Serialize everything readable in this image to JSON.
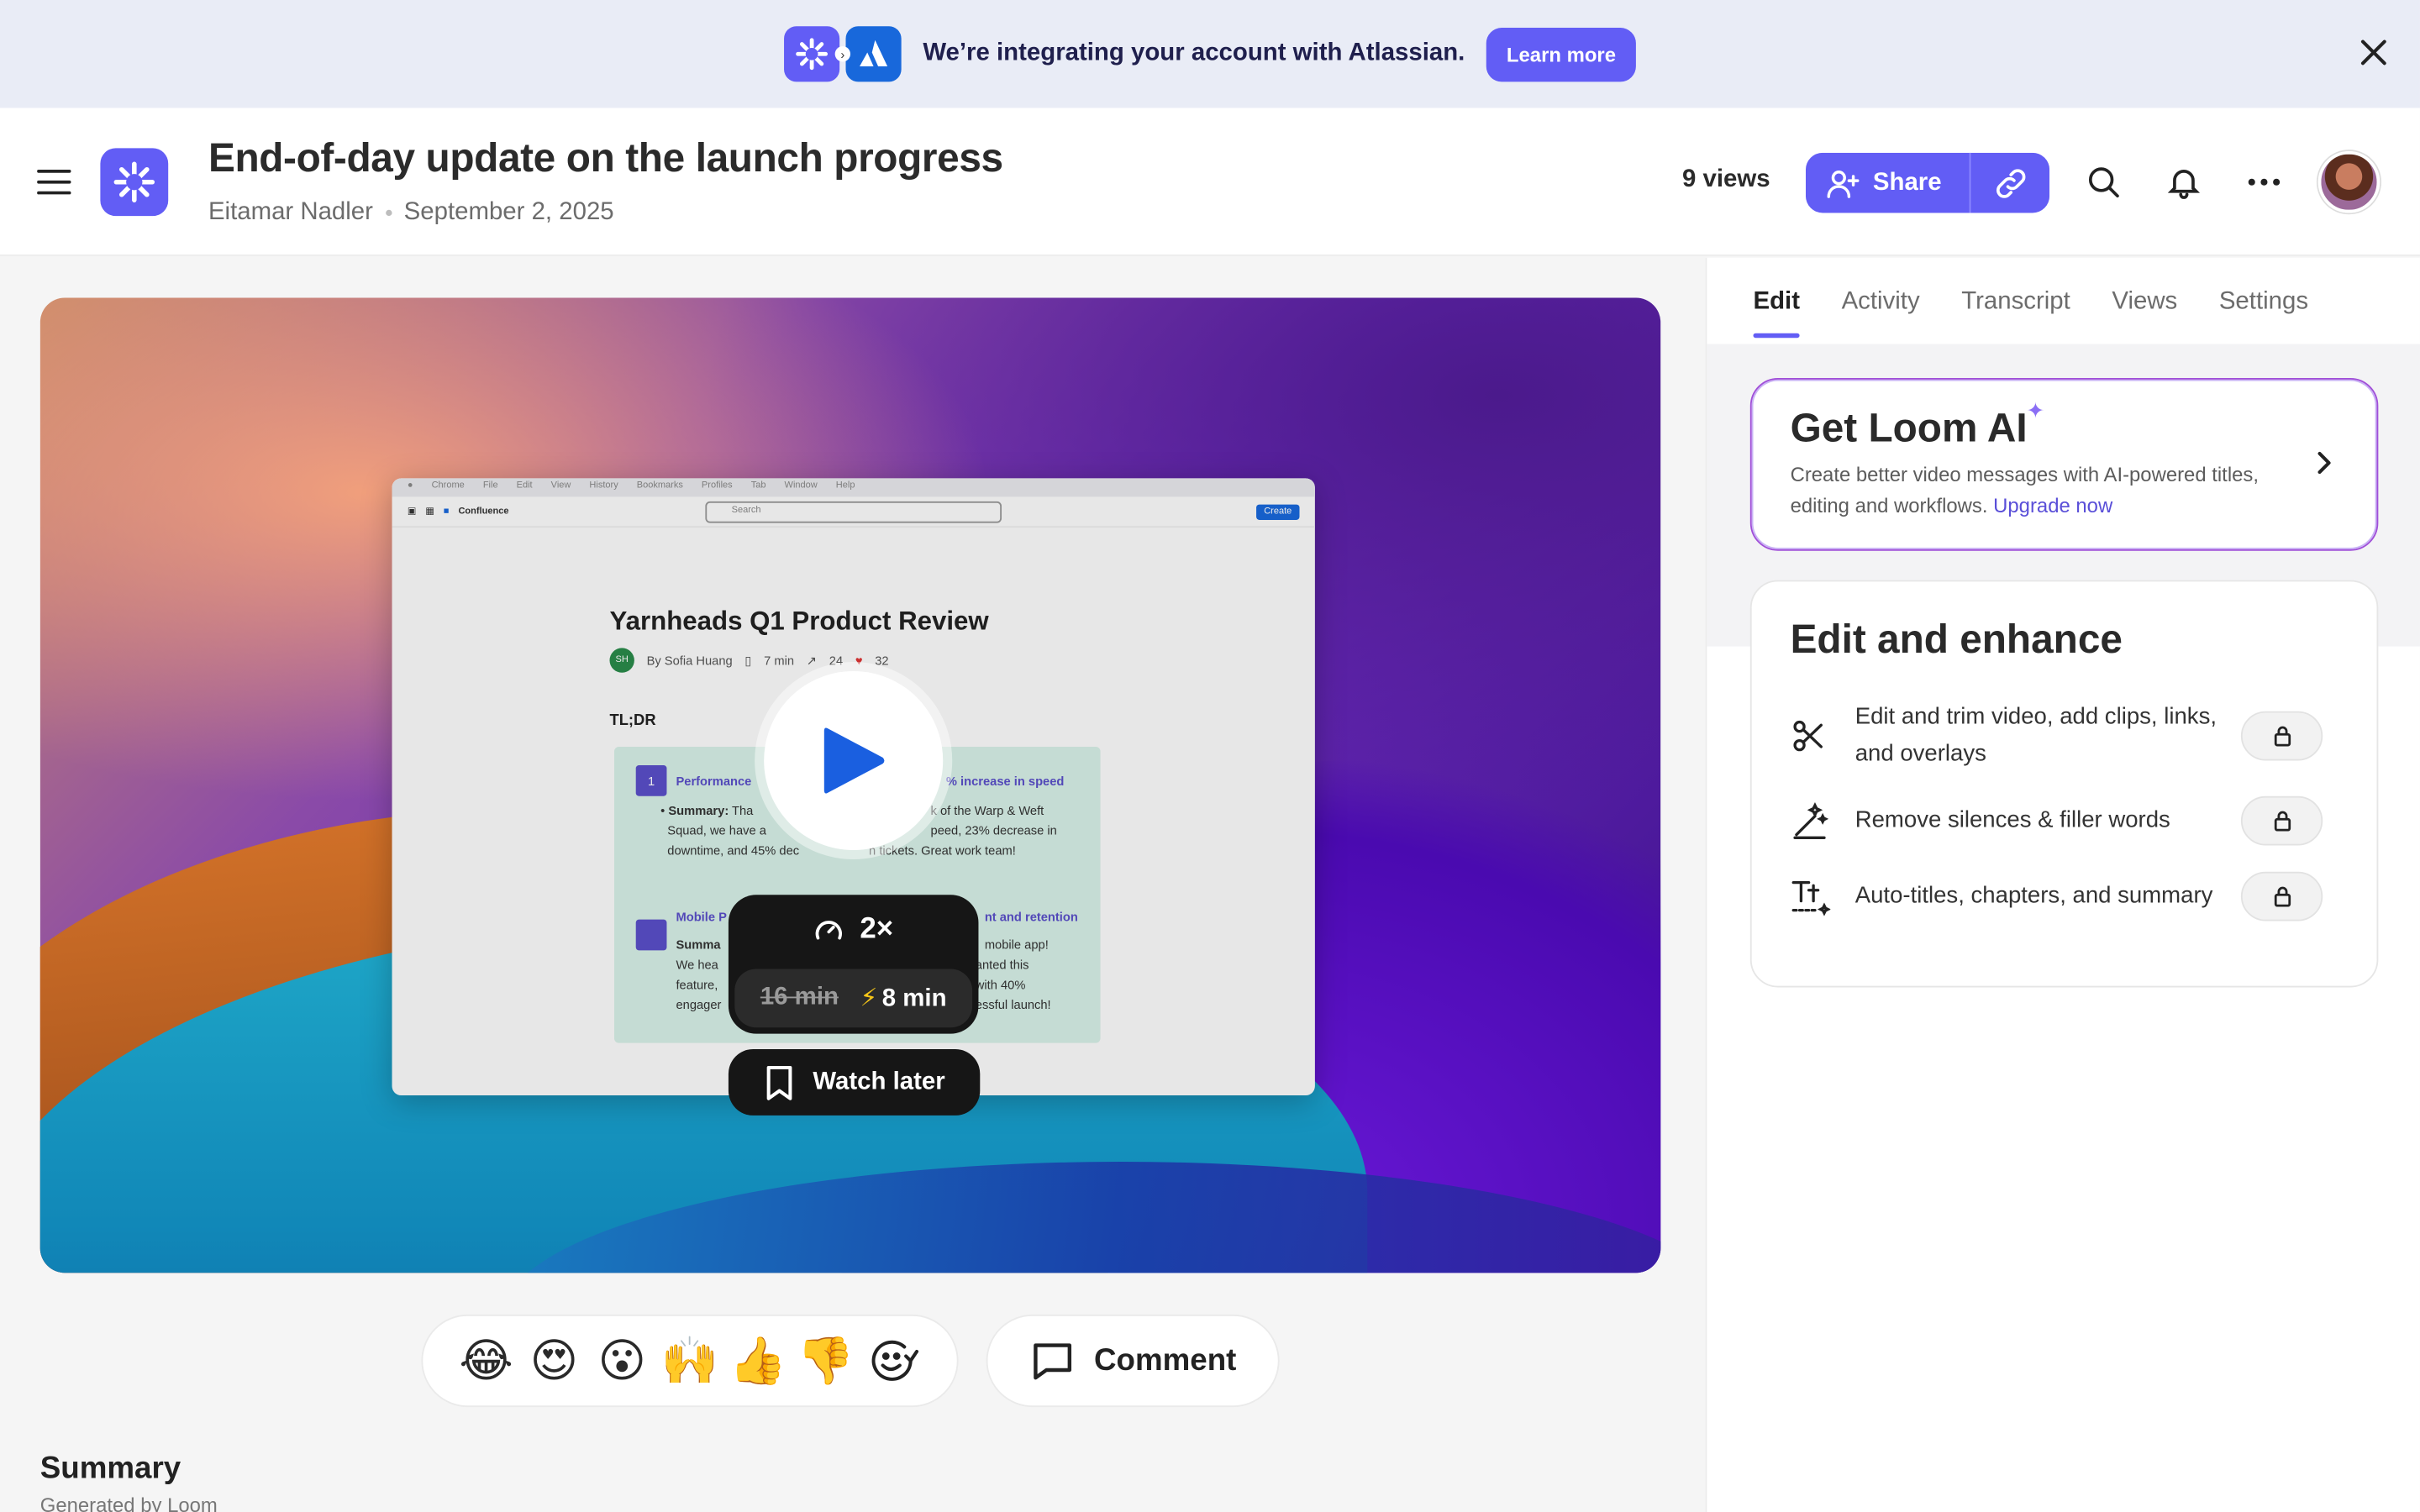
{
  "banner": {
    "message": "We’re integrating your account with Atlassian.",
    "learn_more": "Learn more"
  },
  "header": {
    "title": "End-of-day update on the launch progress",
    "author": "Eitamar Nadler",
    "date": "September 2, 2025",
    "views": "9 views",
    "share_label": "Share"
  },
  "video": {
    "screen": {
      "menubar": [
        "Chrome",
        "File",
        "Edit",
        "View",
        "History",
        "Bookmarks",
        "Profiles",
        "Tab",
        "Window",
        "Help"
      ],
      "app_name": "Confluence",
      "search_placeholder": "Search",
      "create_label": "Create",
      "doc_title": "Yarnheads Q1 Product Review",
      "doc_author_initials": "SH",
      "doc_author": "By Sofia Huang",
      "doc_read_time": "7 min",
      "doc_views": "24",
      "doc_reactions": "32",
      "tldr": "TL;DR",
      "item1_num": "1",
      "item1_head": "Performance",
      "item1_head_right": "% increase in speed",
      "item1_label": "Summary:",
      "item1_text_a": "Tha",
      "item1_text_b": "k of the Warp & Weft",
      "item1_line2_a": "Squad, we have a",
      "item1_line2_b": "peed, 23% decrease in",
      "item1_line3": "downtime, and 45% dec",
      "item1_line3_b": "n tickets. Great work team!",
      "item2_head": "Mobile P",
      "item2_head_right": "nt and retention",
      "item2_label": "Summa",
      "item2_line1_b": "mobile app!",
      "item2_line2_a": "We hea",
      "item2_line2_b": "anted this",
      "item2_line3_a": "feature,",
      "item2_line3_b": "with 40%",
      "item2_line4_a": "engager",
      "item2_line4_b": "essful launch!"
    },
    "speed": "2×",
    "original_duration": "16 min",
    "fast_duration": "8 min",
    "watch_later": "Watch later"
  },
  "reactions": [
    "😂",
    "😍",
    "😮",
    "🙌",
    "👍",
    "👎"
  ],
  "comment_label": "Comment",
  "summary": {
    "heading": "Summary",
    "sub": "Generated by Loom"
  },
  "sidebar": {
    "tabs": [
      "Edit",
      "Activity",
      "Transcript",
      "Views",
      "Settings"
    ],
    "active_tab": "Edit",
    "ai_card": {
      "title": "Get Loom AI",
      "desc": "Create better video messages with AI-powered titles, editing and workflows.",
      "link": "Upgrade now"
    },
    "enhance": {
      "title": "Edit and enhance",
      "items": [
        {
          "label": "Edit and trim video, add clips, links, and overlays",
          "icon": "scissors-icon"
        },
        {
          "label": "Remove silences & filler words",
          "icon": "magic-wand-icon"
        },
        {
          "label": "Auto-titles, chapters, and summary",
          "icon": "text-size-icon"
        }
      ]
    }
  },
  "colors": {
    "accent": "#625df5",
    "atlassian": "#1868db",
    "dark": "#161616"
  }
}
